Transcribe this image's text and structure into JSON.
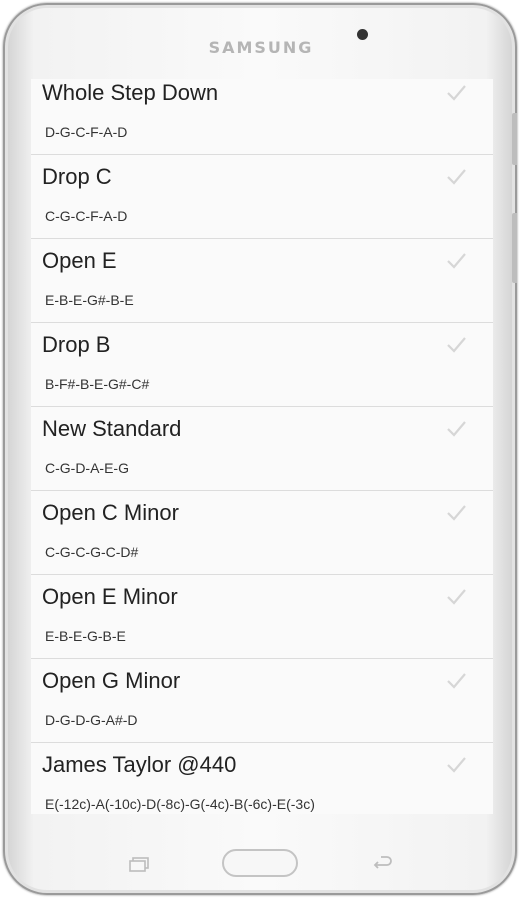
{
  "device": {
    "brand": "SAMSUNG"
  },
  "tunings": [
    {
      "name": "Whole Step Down",
      "notes": "D-G-C-F-A-D"
    },
    {
      "name": "Drop C",
      "notes": "C-G-C-F-A-D"
    },
    {
      "name": "Open E",
      "notes": "E-B-E-G#-B-E"
    },
    {
      "name": "Drop B",
      "notes": "B-F#-B-E-G#-C#"
    },
    {
      "name": "New Standard",
      "notes": "C-G-D-A-E-G"
    },
    {
      "name": "Open C Minor",
      "notes": "C-G-C-G-C-D#"
    },
    {
      "name": "Open E Minor",
      "notes": "E-B-E-G-B-E"
    },
    {
      "name": "Open G Minor",
      "notes": "D-G-D-G-A#-D"
    },
    {
      "name": "James Taylor @440",
      "notes": "E(-12c)-A(-10c)-D(-8c)-G(-4c)-B(-6c)-E(-3c)"
    }
  ],
  "icons": {
    "check": "check-icon",
    "recent": "recent-apps-icon",
    "home": "home-button",
    "back": "back-icon"
  },
  "colors": {
    "check": "#d6d6d6",
    "text": "#222222"
  }
}
